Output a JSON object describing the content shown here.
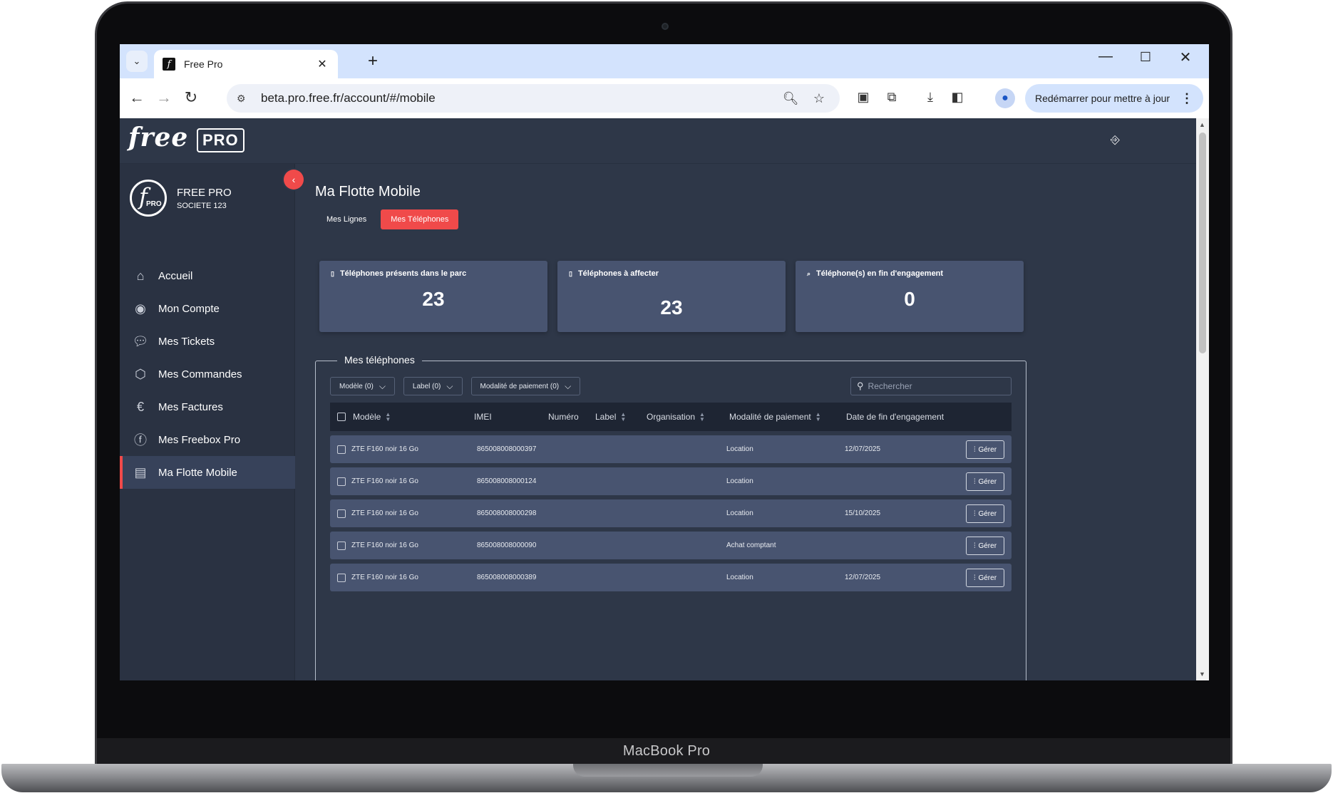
{
  "device": {
    "brand_label": "MacBook Pro"
  },
  "browser": {
    "tab_title": "Free Pro",
    "url": "beta.pro.free.fr/account/#/mobile",
    "update_label": "Redémarrer pour mettre à jour"
  },
  "app": {
    "logo_free": "free",
    "logo_pro": "PRO",
    "profile": {
      "logo_f": "f",
      "logo_pro": "PRO",
      "name": "FREE PRO",
      "company": "SOCIETE 123"
    },
    "sidebar": {
      "items": [
        {
          "label": "Accueil",
          "icon": "home-icon"
        },
        {
          "label": "Mon Compte",
          "icon": "user-icon"
        },
        {
          "label": "Mes Tickets",
          "icon": "chat-icon"
        },
        {
          "label": "Mes Commandes",
          "icon": "box-icon"
        },
        {
          "label": "Mes Factures",
          "icon": "euro-icon"
        },
        {
          "label": "Mes Freebox Pro",
          "icon": "freebox-icon"
        },
        {
          "label": "Ma Flotte Mobile",
          "icon": "phone-icon",
          "active": true
        }
      ]
    },
    "page_title": "Ma Flotte Mobile",
    "tabs": [
      {
        "label": "Mes Lignes",
        "active": false
      },
      {
        "label": "Mes Téléphones",
        "active": true
      }
    ],
    "cards": [
      {
        "label": "Téléphones présents dans le parc",
        "value": "23"
      },
      {
        "label": "Téléphones à affecter",
        "value": "23"
      },
      {
        "label": "Téléphone(s) en fin d'engagement",
        "value": "0"
      }
    ],
    "section_title": "Mes téléphones",
    "filters": [
      {
        "label": "Modèle (0)"
      },
      {
        "label": "Label (0)"
      },
      {
        "label": "Modalité de paiement (0)"
      }
    ],
    "search_placeholder": "Rechercher",
    "columns": {
      "model": "Modèle",
      "imei": "IMEI",
      "number": "Numéro",
      "label": "Label",
      "organisation": "Organisation",
      "payment": "Modalité de paiement",
      "end_date": "Date de fin d'engagement"
    },
    "manage_label": "Gérer",
    "rows": [
      {
        "model": "ZTE F160 noir 16 Go",
        "imei": "865008008000397",
        "number": "",
        "label": "",
        "organisation": "",
        "payment": "Location",
        "end_date": "12/07/2025"
      },
      {
        "model": "ZTE F160 noir 16 Go",
        "imei": "865008008000124",
        "number": "",
        "label": "",
        "organisation": "",
        "payment": "Location",
        "end_date": ""
      },
      {
        "model": "ZTE F160 noir 16 Go",
        "imei": "865008008000298",
        "number": "",
        "label": "",
        "organisation": "",
        "payment": "Location",
        "end_date": "15/10/2025"
      },
      {
        "model": "ZTE F160 noir 16 Go",
        "imei": "865008008000090",
        "number": "",
        "label": "",
        "organisation": "",
        "payment": "Achat comptant",
        "end_date": ""
      },
      {
        "model": "ZTE F160 noir 16 Go",
        "imei": "865008008000389",
        "number": "",
        "label": "",
        "organisation": "",
        "payment": "Location",
        "end_date": "12/07/2025"
      }
    ],
    "colors": {
      "accent": "#f04a4a",
      "background": "#2e3748",
      "card": "#485470",
      "sidebar": "#2a3242"
    }
  }
}
